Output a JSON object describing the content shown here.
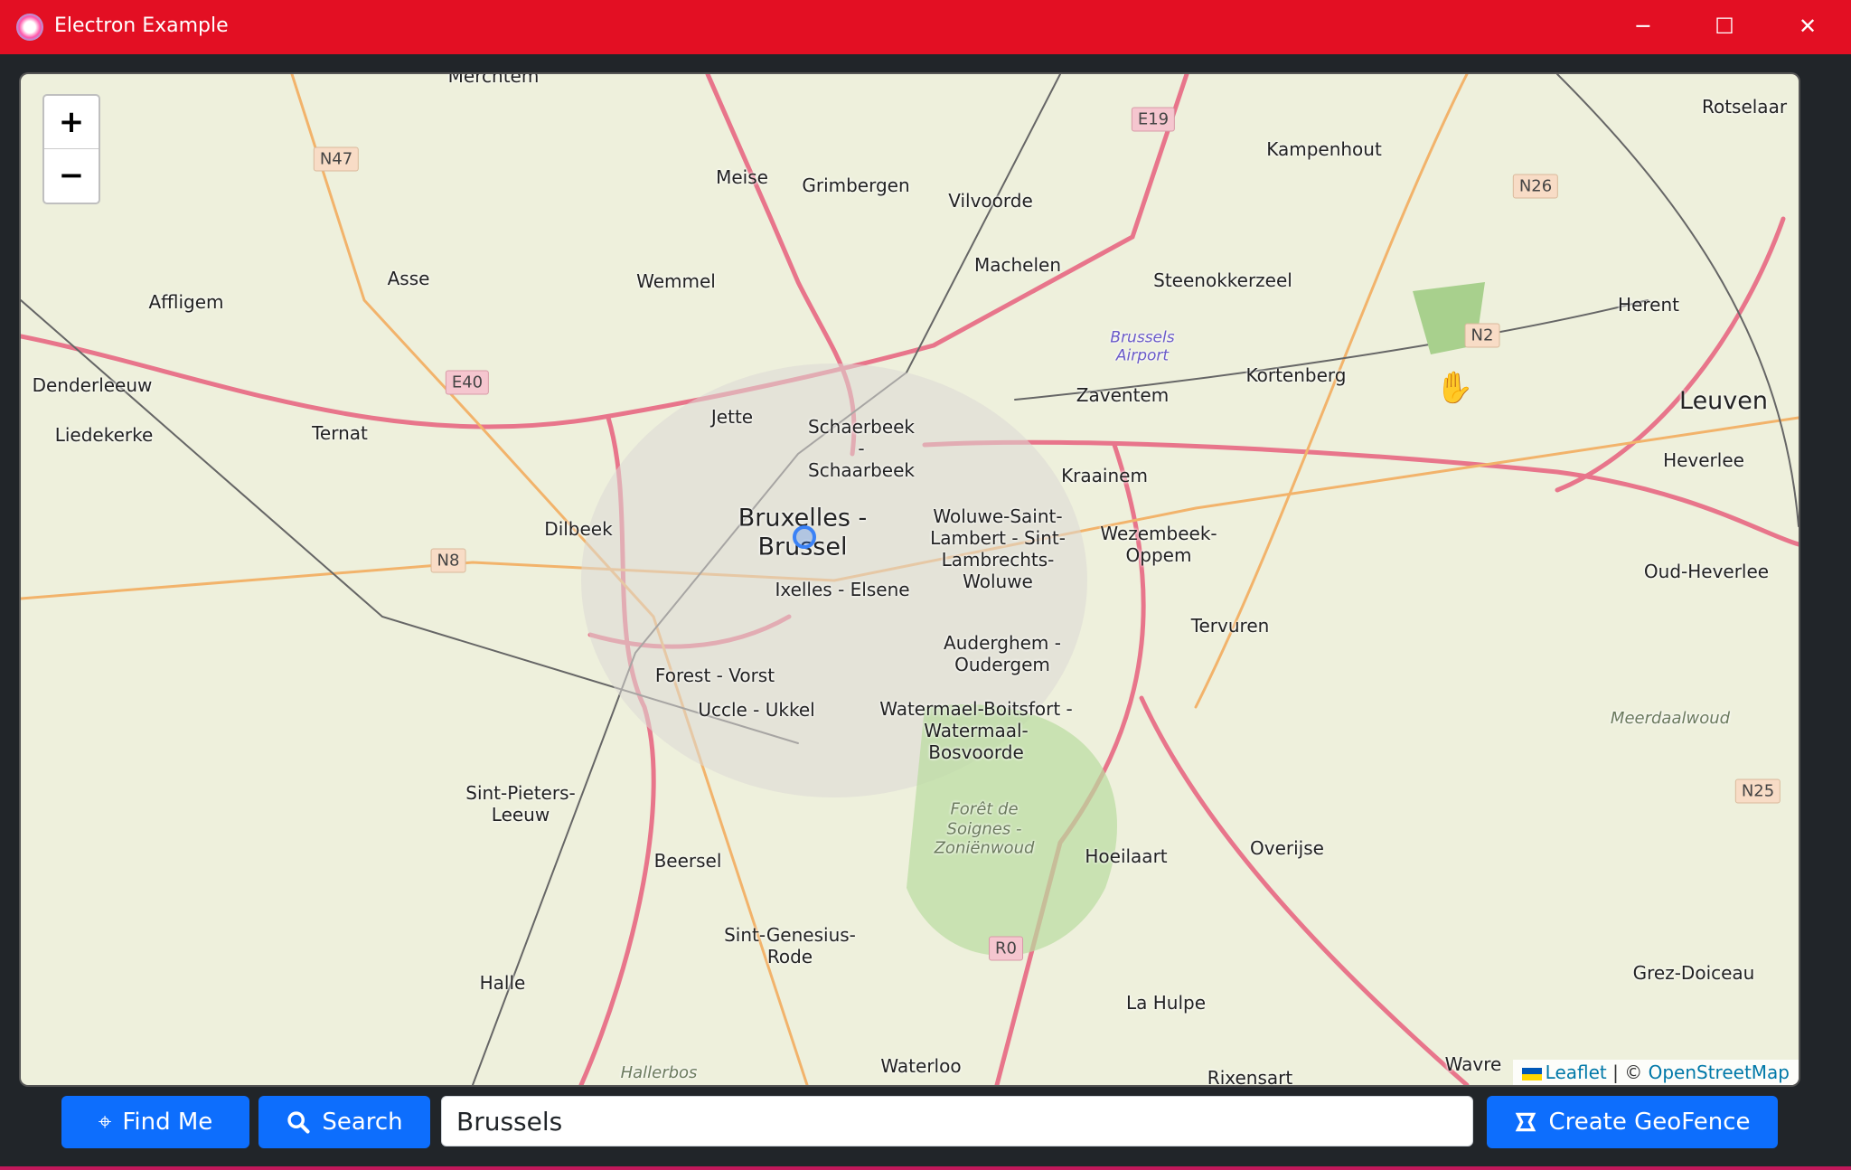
{
  "window": {
    "title": "Electron Example",
    "minimize": "─",
    "maximize": "☐",
    "close": "✕"
  },
  "map": {
    "zoom_in": "+",
    "zoom_out": "−",
    "places": [
      "Merchtem",
      "Meise",
      "Grimbergen",
      "Vilvoorde",
      "Kampenhout",
      "Rotselaar",
      "Machelen",
      "Steenokkerzeel",
      "Herent",
      "Affligem",
      "Asse",
      "Wemmel",
      "Kortenberg",
      "Zaventem",
      "Leuven",
      "Denderleeuw",
      "Liedekerke",
      "Ternat",
      "Jette",
      "Schaerbeek - Schaarbeek",
      "Kraainem",
      "Heverlee",
      "Bruxelles - Brussel",
      "Dilbeek",
      "Woluwe-Saint-Lambert - Sint-Lambrechts-Woluwe",
      "Wezembeek-Oppem",
      "Oud-Heverlee",
      "Ixelles - Elsene",
      "Tervuren",
      "Auderghem - Oudergem",
      "Forest - Vorst",
      "Uccle - Ukkel",
      "Watermael-Boitsfort - Watermaal-Bosvoorde",
      "Sint-Pieters-Leeuw",
      "Hoeilaart",
      "Overijse",
      "Beersel",
      "Sint-Genesius-Rode",
      "Halle",
      "Grez-Doiceau",
      "La Hulpe",
      "Waterloo",
      "Rixensart",
      "Wavre"
    ],
    "natural": [
      "Forêt de Soignes - Zoniënwoud",
      "Meerdaalwoud",
      "Hallerbos"
    ],
    "airport": "Brussels Airport",
    "shields": [
      "N47",
      "E19",
      "N26",
      "E40",
      "N2",
      "N8",
      "N25",
      "R0"
    ],
    "attribution": {
      "leaflet": "Leaflet",
      "sep": "| ©",
      "osm": "OpenStreetMap"
    }
  },
  "toolbar": {
    "find_me": "Find Me",
    "search": "Search",
    "search_value": "Brussels",
    "create_geofence": "Create GeoFence"
  },
  "colors": {
    "titlebar": "#e30f23",
    "button": "#0d6efd",
    "background": "#212529"
  }
}
